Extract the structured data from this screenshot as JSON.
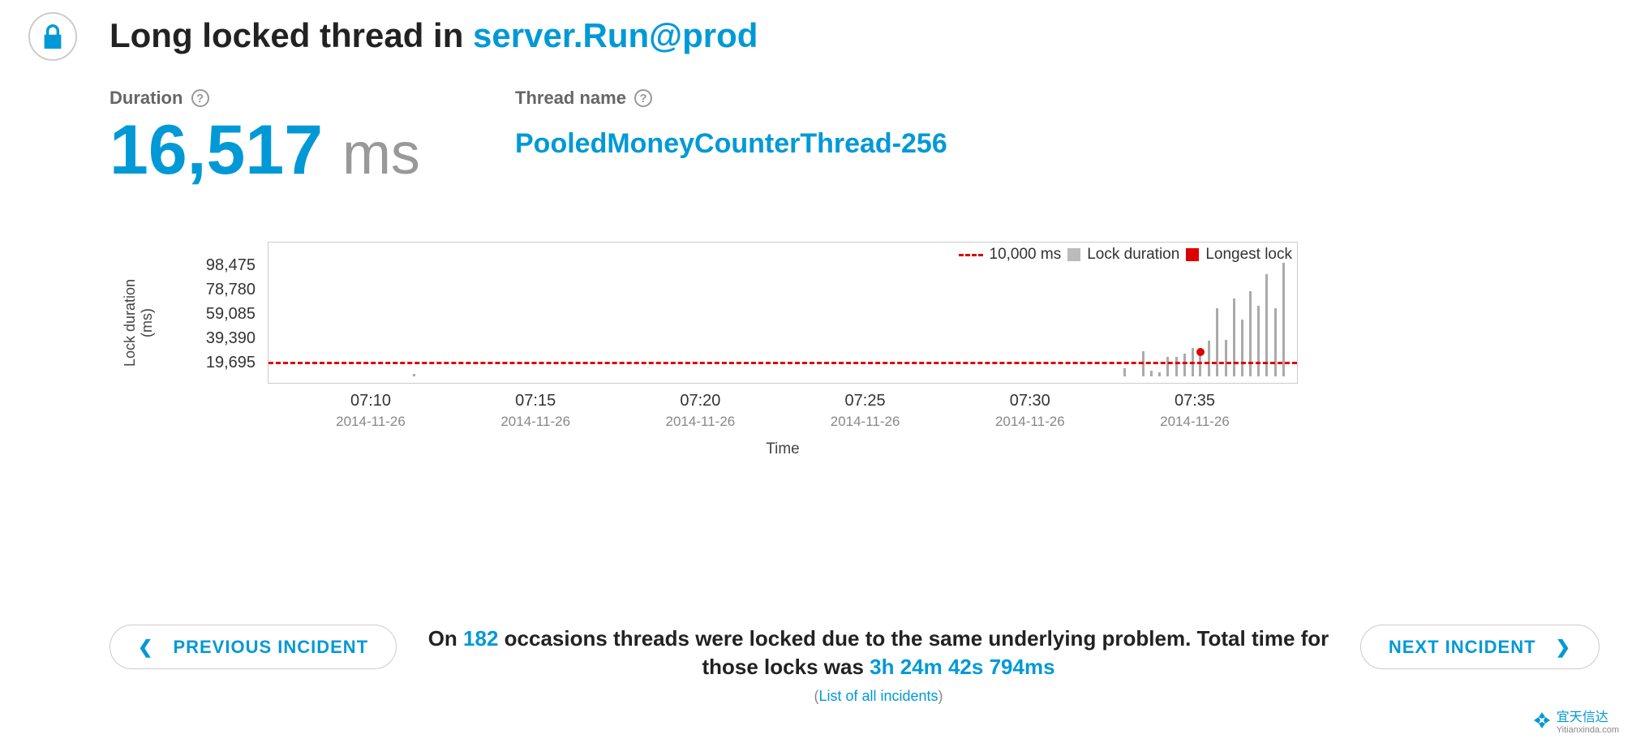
{
  "title_prefix": "Long locked thread in ",
  "title_link": "server.Run@prod",
  "duration": {
    "label": "Duration",
    "value": "16,517",
    "unit": "ms"
  },
  "thread": {
    "label": "Thread name",
    "value": "PooledMoneyCounterThread-256"
  },
  "nav": {
    "prev": "PREVIOUS INCIDENT",
    "next": "NEXT INCIDENT"
  },
  "summary": {
    "t1": "On ",
    "count": "182",
    "t2": " occasions threads were locked due to the same underlying problem. Total time for those locks was ",
    "total": "3h 24m 42s 794ms",
    "list_link": "List of all incidents"
  },
  "brand": {
    "name": "宜天信达",
    "domain": "Yitianxinda.com"
  },
  "chart_data": {
    "type": "bar",
    "title": "",
    "xlabel": "Time",
    "ylabel": "Lock duration (ms)",
    "ylim": [
      0,
      100000
    ],
    "yticks": [
      19695,
      39390,
      59085,
      78780,
      98475
    ],
    "threshold": {
      "value": 10000,
      "label": "10,000 ms"
    },
    "legend": [
      "10,000 ms",
      "Lock duration",
      "Longest lock"
    ],
    "xticks": [
      {
        "t": "07:10",
        "d": "2014-11-26",
        "rel": 0.1
      },
      {
        "t": "07:15",
        "d": "2014-11-26",
        "rel": 0.26
      },
      {
        "t": "07:20",
        "d": "2014-11-26",
        "rel": 0.42
      },
      {
        "t": "07:25",
        "d": "2014-11-26",
        "rel": 0.58
      },
      {
        "t": "07:30",
        "d": "2014-11-26",
        "rel": 0.74
      },
      {
        "t": "07:35",
        "d": "2014-11-26",
        "rel": 0.9
      }
    ],
    "bars": [
      {
        "rel": 0.14,
        "v": 2000
      },
      {
        "rel": 0.83,
        "v": 6000
      },
      {
        "rel": 0.848,
        "v": 18000
      },
      {
        "rel": 0.856,
        "v": 4000
      },
      {
        "rel": 0.864,
        "v": 3000
      },
      {
        "rel": 0.872,
        "v": 14000
      },
      {
        "rel": 0.88,
        "v": 14000
      },
      {
        "rel": 0.888,
        "v": 16000
      },
      {
        "rel": 0.896,
        "v": 20000
      },
      {
        "rel": 0.903,
        "v": 16517,
        "longest": true
      },
      {
        "rel": 0.912,
        "v": 25000
      },
      {
        "rel": 0.92,
        "v": 48000
      },
      {
        "rel": 0.928,
        "v": 26000
      },
      {
        "rel": 0.936,
        "v": 55000
      },
      {
        "rel": 0.944,
        "v": 40000
      },
      {
        "rel": 0.952,
        "v": 60000
      },
      {
        "rel": 0.96,
        "v": 50000
      },
      {
        "rel": 0.968,
        "v": 72000
      },
      {
        "rel": 0.976,
        "v": 48000
      },
      {
        "rel": 0.984,
        "v": 80000
      }
    ]
  }
}
